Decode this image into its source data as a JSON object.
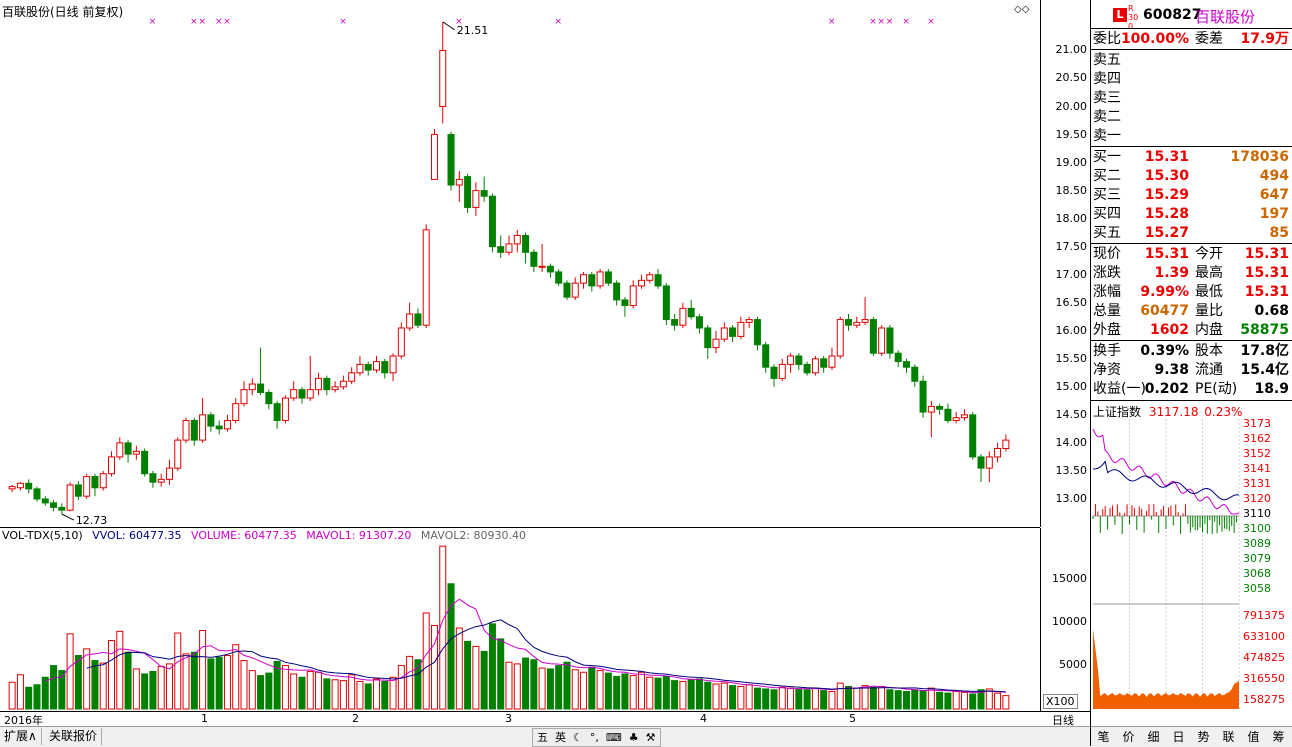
{
  "chart_title": "百联股份(日线 前复权)",
  "max_label": "21.51",
  "min_label": "12.73",
  "price_ticks": [
    "21.00",
    "20.50",
    "20.00",
    "19.50",
    "19.00",
    "18.50",
    "18.00",
    "17.50",
    "17.00",
    "16.50",
    "16.00",
    "15.50",
    "15.00",
    "14.50",
    "14.00",
    "13.50",
    "13.00"
  ],
  "vol_legend": {
    "name": "VOL-TDX(5,10)",
    "vvol": "VVOL: 60477.35",
    "volume": "VOLUME: 60477.35",
    "mavol1": "MAVOL1: 91307.20",
    "mavol2": "MAVOL2: 80930.40"
  },
  "vol_ticks": [
    "15000",
    "10000",
    "5000"
  ],
  "vol_unit": "X100",
  "dates": [
    "2016年",
    "1",
    "2",
    "3",
    "4",
    "5"
  ],
  "period": "日线",
  "bottom_buttons": [
    "扩展∧",
    "关联报价"
  ],
  "colors": {
    "up": "#e00000",
    "down": "#008000",
    "ma1": "#cc00cc",
    "ma2": "#000080",
    "text_red": "#e00000"
  },
  "chart_data": {
    "type": "candlestick",
    "ylim": [
      12.5,
      21.9
    ],
    "candles": [
      [
        13.18,
        13.22,
        13.25,
        13.12
      ],
      [
        13.2,
        13.28,
        13.3,
        13.15
      ],
      [
        13.28,
        13.18,
        13.35,
        13.1
      ],
      [
        13.18,
        13.0,
        13.22,
        12.95
      ],
      [
        13.0,
        12.93,
        13.05,
        12.88
      ],
      [
        12.93,
        12.85,
        12.98,
        12.78
      ],
      [
        12.85,
        12.8,
        12.92,
        12.73
      ],
      [
        12.8,
        13.25,
        13.3,
        12.78
      ],
      [
        13.25,
        13.05,
        13.32,
        12.98
      ],
      [
        13.05,
        13.4,
        13.45,
        13.0
      ],
      [
        13.4,
        13.2,
        13.45,
        13.05
      ],
      [
        13.2,
        13.45,
        13.5,
        13.15
      ],
      [
        13.45,
        13.75,
        13.85,
        13.4
      ],
      [
        13.75,
        14.0,
        14.1,
        13.7
      ],
      [
        14.0,
        13.8,
        14.05,
        13.65
      ],
      [
        13.8,
        13.85,
        13.95,
        13.7
      ],
      [
        13.85,
        13.45,
        13.9,
        13.4
      ],
      [
        13.45,
        13.3,
        13.5,
        13.2
      ],
      [
        13.3,
        13.35,
        13.45,
        13.22
      ],
      [
        13.35,
        13.55,
        13.7,
        13.25
      ],
      [
        13.55,
        14.05,
        14.1,
        13.5
      ],
      [
        14.05,
        14.4,
        14.45,
        14.0
      ],
      [
        14.4,
        14.05,
        14.45,
        13.95
      ],
      [
        14.05,
        14.5,
        14.8,
        14.0
      ],
      [
        14.5,
        14.3,
        14.55,
        14.2
      ],
      [
        14.3,
        14.25,
        14.4,
        14.15
      ],
      [
        14.25,
        14.4,
        14.5,
        14.2
      ],
      [
        14.4,
        14.7,
        14.8,
        14.35
      ],
      [
        14.7,
        14.95,
        15.1,
        14.65
      ],
      [
        14.95,
        15.05,
        15.15,
        14.85
      ],
      [
        15.05,
        14.9,
        15.7,
        14.85
      ],
      [
        14.9,
        14.7,
        14.95,
        14.6
      ],
      [
        14.7,
        14.4,
        14.75,
        14.25
      ],
      [
        14.4,
        14.8,
        14.85,
        14.35
      ],
      [
        14.8,
        14.95,
        15.1,
        14.75
      ],
      [
        14.95,
        14.8,
        15.0,
        14.7
      ],
      [
        14.8,
        14.95,
        15.55,
        14.75
      ],
      [
        14.95,
        15.15,
        15.25,
        14.85
      ],
      [
        15.15,
        14.95,
        15.2,
        14.85
      ],
      [
        14.95,
        15.0,
        15.1,
        14.9
      ],
      [
        15.0,
        15.1,
        15.2,
        14.95
      ],
      [
        15.1,
        15.25,
        15.35,
        15.05
      ],
      [
        15.25,
        15.4,
        15.55,
        15.2
      ],
      [
        15.4,
        15.3,
        15.45,
        15.2
      ],
      [
        15.3,
        15.45,
        15.55,
        15.25
      ],
      [
        15.45,
        15.25,
        15.5,
        15.15
      ],
      [
        15.25,
        15.55,
        15.6,
        15.1
      ],
      [
        15.55,
        16.05,
        16.15,
        15.5
      ],
      [
        16.05,
        16.3,
        16.5,
        16.0
      ],
      [
        16.3,
        16.1,
        16.4,
        16.05
      ],
      [
        16.1,
        17.8,
        17.9,
        16.05
      ],
      [
        18.7,
        19.5,
        19.6,
        19.0
      ],
      [
        20.0,
        21.0,
        21.51,
        19.7
      ],
      [
        19.5,
        18.6,
        19.55,
        18.5
      ],
      [
        18.6,
        18.7,
        18.85,
        18.3
      ],
      [
        18.75,
        18.2,
        18.8,
        18.1
      ],
      [
        18.2,
        18.5,
        18.65,
        18.05
      ],
      [
        18.5,
        18.4,
        18.75,
        18.3
      ],
      [
        18.4,
        17.5,
        18.45,
        17.4
      ],
      [
        17.5,
        17.4,
        17.7,
        17.3
      ],
      [
        17.4,
        17.55,
        17.7,
        17.35
      ],
      [
        17.55,
        17.7,
        17.8,
        17.4
      ],
      [
        17.7,
        17.4,
        17.75,
        17.2
      ],
      [
        17.4,
        17.15,
        17.45,
        17.05
      ],
      [
        17.15,
        17.15,
        17.55,
        17.05
      ],
      [
        17.15,
        17.05,
        17.2,
        16.95
      ],
      [
        17.05,
        16.85,
        17.1,
        16.8
      ],
      [
        16.85,
        16.6,
        16.9,
        16.55
      ],
      [
        16.6,
        16.85,
        16.95,
        16.55
      ],
      [
        16.85,
        17.0,
        17.05,
        16.75
      ],
      [
        17.0,
        16.8,
        17.05,
        16.7
      ],
      [
        16.8,
        17.05,
        17.1,
        16.75
      ],
      [
        17.05,
        16.85,
        17.1,
        16.8
      ],
      [
        16.85,
        16.55,
        16.9,
        16.45
      ],
      [
        16.55,
        16.45,
        16.6,
        16.25
      ],
      [
        16.45,
        16.8,
        16.9,
        16.4
      ],
      [
        16.8,
        16.9,
        17.0,
        16.75
      ],
      [
        16.9,
        17.0,
        17.05,
        16.85
      ],
      [
        17.0,
        16.8,
        17.1,
        16.75
      ],
      [
        16.8,
        16.2,
        16.85,
        16.1
      ],
      [
        16.2,
        16.1,
        16.3,
        16.0
      ],
      [
        16.1,
        16.4,
        16.5,
        16.05
      ],
      [
        16.4,
        16.25,
        16.55,
        16.2
      ],
      [
        16.25,
        16.05,
        16.3,
        15.95
      ],
      [
        16.05,
        15.7,
        16.1,
        15.5
      ],
      [
        15.7,
        15.85,
        16.0,
        15.6
      ],
      [
        15.85,
        16.05,
        16.15,
        15.8
      ],
      [
        16.05,
        15.9,
        16.1,
        15.8
      ],
      [
        15.9,
        16.15,
        16.25,
        15.85
      ],
      [
        16.15,
        16.2,
        16.25,
        16.05
      ],
      [
        16.2,
        15.75,
        16.25,
        15.65
      ],
      [
        15.75,
        15.35,
        15.8,
        15.25
      ],
      [
        15.35,
        15.15,
        15.4,
        15.0
      ],
      [
        15.15,
        15.4,
        15.5,
        15.1
      ],
      [
        15.4,
        15.55,
        15.6,
        15.25
      ],
      [
        15.55,
        15.4,
        15.6,
        15.3
      ],
      [
        15.4,
        15.25,
        15.45,
        15.2
      ],
      [
        15.25,
        15.5,
        15.55,
        15.2
      ],
      [
        15.5,
        15.35,
        15.55,
        15.25
      ],
      [
        15.35,
        15.55,
        15.7,
        15.3
      ],
      [
        15.55,
        16.2,
        16.25,
        15.5
      ],
      [
        16.2,
        16.1,
        16.3,
        16.0
      ],
      [
        16.1,
        16.15,
        16.25,
        16.05
      ],
      [
        16.15,
        16.2,
        16.6,
        16.1
      ],
      [
        16.2,
        15.6,
        16.25,
        15.55
      ],
      [
        15.6,
        16.05,
        16.1,
        15.55
      ],
      [
        16.05,
        15.6,
        16.1,
        15.5
      ],
      [
        15.6,
        15.45,
        15.65,
        15.35
      ],
      [
        15.45,
        15.35,
        15.5,
        15.25
      ],
      [
        15.35,
        15.1,
        15.4,
        15.0
      ],
      [
        15.1,
        14.55,
        15.2,
        14.45
      ],
      [
        14.55,
        14.65,
        14.75,
        14.1
      ],
      [
        14.65,
        14.6,
        14.7,
        14.5
      ],
      [
        14.6,
        14.4,
        14.7,
        14.35
      ],
      [
        14.4,
        14.45,
        14.55,
        14.35
      ],
      [
        14.45,
        14.5,
        14.6,
        14.4
      ],
      [
        14.5,
        13.75,
        14.55,
        13.7
      ],
      [
        13.75,
        13.55,
        13.8,
        13.3
      ],
      [
        13.55,
        13.75,
        13.85,
        13.3
      ],
      [
        13.75,
        13.9,
        14.0,
        13.65
      ],
      [
        13.9,
        14.05,
        14.15,
        13.85
      ]
    ],
    "volume": [
      3200,
      4100,
      2600,
      2900,
      3800,
      5200,
      4600,
      9000,
      6400,
      7200,
      5800,
      5500,
      8200,
      9300,
      6800,
      4800,
      4200,
      4500,
      5100,
      5400,
      9100,
      6600,
      6800,
      9400,
      6000,
      6200,
      6400,
      7700,
      5800,
      4600,
      4000,
      4300,
      5700,
      5200,
      4200,
      3800,
      4500,
      4400,
      3600,
      3500,
      3400,
      4100,
      3300,
      3000,
      3600,
      3300,
      3800,
      5200,
      6300,
      5900,
      11500,
      10000,
      19500,
      15000,
      9700,
      8100,
      7500,
      6900,
      10200,
      8400,
      5600,
      5400,
      6100,
      5900,
      4900,
      4800,
      5200,
      5600,
      4700,
      4400,
      5000,
      4600,
      4300,
      3900,
      4200,
      4000,
      4400,
      3800,
      3700,
      3900,
      3400,
      3300,
      3500,
      3600,
      3200,
      3000,
      3100,
      2800,
      2700,
      2900,
      2500,
      2400,
      2300,
      2600,
      2500,
      2400,
      2300,
      2500,
      2200,
      2100,
      3100,
      2700,
      2500,
      2800,
      2600,
      2700,
      2300,
      2200,
      2100,
      2300,
      2200,
      2500,
      2000,
      1900,
      2100,
      2000,
      1800,
      2300,
      2400,
      1900,
      1600
    ],
    "yaxis_ticks": [
      21.0,
      20.5,
      20.0,
      19.5,
      19.0,
      18.5,
      18.0,
      17.5,
      17.0,
      16.5,
      16.0,
      15.5,
      15.0,
      14.5,
      14.0,
      13.5,
      13.0
    ],
    "vol_ylim": [
      0,
      20000
    ]
  },
  "quote": {
    "badge": "L",
    "badge2": "R 300",
    "code": "600827",
    "name": "百联股份",
    "weibi_label": "委比",
    "weibi": "100.00%",
    "weicha_label": "委差",
    "weicha": "17.9万",
    "sell": [
      "卖五",
      "卖四",
      "卖三",
      "卖二",
      "卖一"
    ],
    "buy": [
      {
        "label": "买一",
        "price": "15.31",
        "vol": "178036"
      },
      {
        "label": "买二",
        "price": "15.30",
        "vol": "494"
      },
      {
        "label": "买三",
        "price": "15.29",
        "vol": "647"
      },
      {
        "label": "买四",
        "price": "15.28",
        "vol": "197"
      },
      {
        "label": "买五",
        "price": "15.27",
        "vol": "85"
      }
    ],
    "stats": [
      {
        "l1": "现价",
        "v1": "15.31",
        "l2": "今开",
        "v2": "15.31"
      },
      {
        "l1": "涨跌",
        "v1": "1.39",
        "l2": "最高",
        "v2": "15.31"
      },
      {
        "l1": "涨幅",
        "v1": "9.99%",
        "l2": "最低",
        "v2": "15.31"
      },
      {
        "l1": "总量",
        "v1": "60477",
        "l2": "量比",
        "v2": "0.68"
      },
      {
        "l1": "外盘",
        "v1": "1602",
        "l2": "内盘",
        "v2": "58875"
      }
    ],
    "stats2": [
      {
        "l1": "换手",
        "v1": "0.39%",
        "l2": "股本",
        "v2": "17.8亿"
      },
      {
        "l1": "净资",
        "v1": "9.38",
        "l2": "流通",
        "v2": "15.4亿"
      },
      {
        "l1": "收益(一)",
        "v1": "0.202",
        "l2": "PE(动)",
        "v2": "18.9"
      }
    ]
  },
  "index_panel": {
    "name": "上证指数",
    "value": "3117.18",
    "pct": "0.23%",
    "right_ticks": [
      "3173",
      "3162",
      "3152",
      "3141",
      "3131",
      "3120",
      "3110",
      "3100",
      "3089",
      "3079",
      "3068",
      "3058",
      "791375",
      "633100",
      "474825",
      "316550",
      "158275"
    ]
  },
  "tabs": [
    "笔",
    "价",
    "细",
    "日",
    "势",
    "联",
    "值",
    "筹"
  ]
}
